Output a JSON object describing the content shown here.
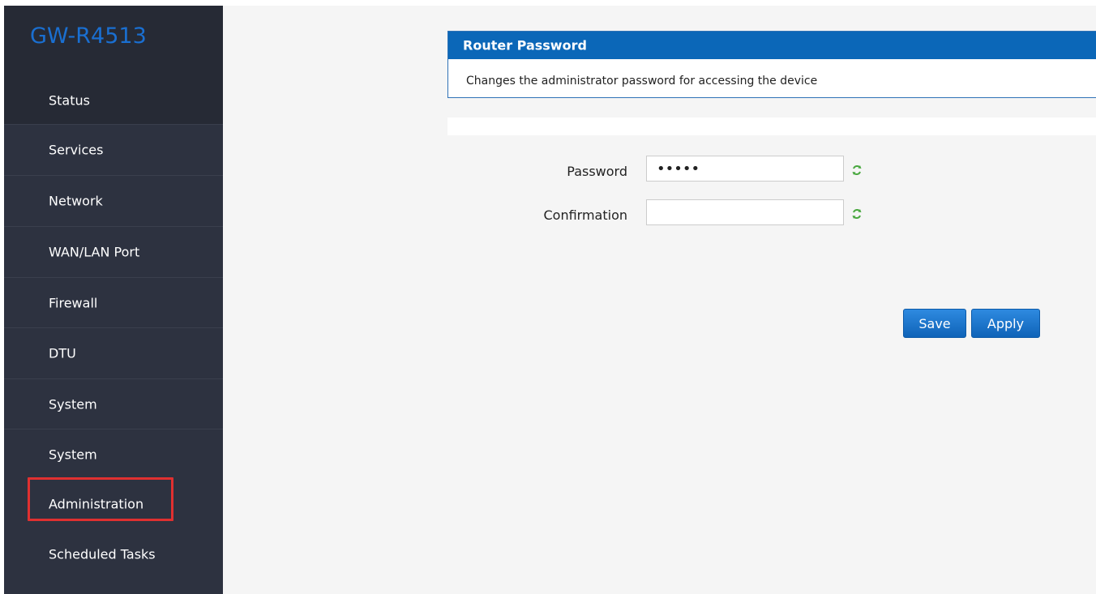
{
  "brand": "GW-R4513",
  "sidebar": {
    "items": [
      {
        "label": "Status"
      },
      {
        "label": "Services"
      },
      {
        "label": "Network"
      },
      {
        "label": "WAN/LAN Port"
      },
      {
        "label": "Firewall"
      },
      {
        "label": "DTU"
      },
      {
        "label": "System"
      },
      {
        "label": "System"
      },
      {
        "label": "Administration"
      },
      {
        "label": "Scheduled Tasks"
      }
    ]
  },
  "panel": {
    "title": "Router Password",
    "description": "Changes the administrator password for accessing the device"
  },
  "form": {
    "password_label": "Password",
    "password_value": "•••••",
    "confirmation_label": "Confirmation",
    "confirmation_value": ""
  },
  "buttons": {
    "save": "Save",
    "apply": "Apply"
  },
  "colors": {
    "accent": "#0b67b8",
    "sidebar": "#2d3240",
    "highlight": "#e03030"
  }
}
